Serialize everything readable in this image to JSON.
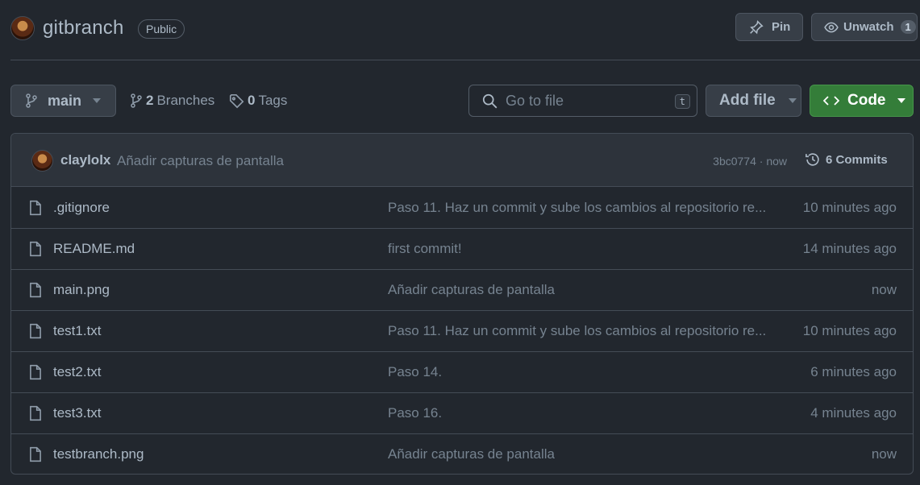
{
  "repo": {
    "name": "gitbranch",
    "visibility": "Public"
  },
  "header_actions": {
    "pin_label": "Pin",
    "unwatch_label": "Unwatch",
    "watch_count": "1"
  },
  "toolbar": {
    "branch": "main",
    "branches_count": "2",
    "branches_label": "Branches",
    "tags_count": "0",
    "tags_label": "Tags",
    "search_placeholder": "Go to file",
    "search_shortcut": "t",
    "add_file_label": "Add file",
    "code_label": "Code"
  },
  "latest_commit": {
    "author": "claylolx",
    "message": "Añadir capturas de pantalla",
    "sha_time": "3bc0774 · now",
    "commits_label": "6 Commits"
  },
  "files": [
    {
      "name": ".gitignore",
      "message": "Paso 11. Haz un commit y sube los cambios al repositorio re...",
      "time": "10 minutes ago"
    },
    {
      "name": "README.md",
      "message": "first commit!",
      "time": "14 minutes ago"
    },
    {
      "name": "main.png",
      "message": "Añadir capturas de pantalla",
      "time": "now"
    },
    {
      "name": "test1.txt",
      "message": "Paso 11. Haz un commit y sube los cambios al repositorio re...",
      "time": "10 minutes ago"
    },
    {
      "name": "test2.txt",
      "message": "Paso 14.",
      "time": "6 minutes ago"
    },
    {
      "name": "test3.txt",
      "message": "Paso 16.",
      "time": "4 minutes ago"
    },
    {
      "name": "testbranch.png",
      "message": "Añadir capturas de pantalla",
      "time": "now"
    }
  ],
  "icons": {
    "avatar": "avatar",
    "pin": "pin-icon",
    "eye": "eye-icon",
    "branch": "git-branch-icon",
    "tag": "tag-icon",
    "search": "search-icon",
    "code": "code-icon",
    "history": "history-icon",
    "file": "file-icon",
    "caret": "triangle-down-icon"
  },
  "colors": {
    "background": "#22272e",
    "surface": "#2d333b",
    "border": "#444c56",
    "accent_green": "#347d39",
    "text_primary": "#adbac7",
    "text_muted": "#768390"
  }
}
